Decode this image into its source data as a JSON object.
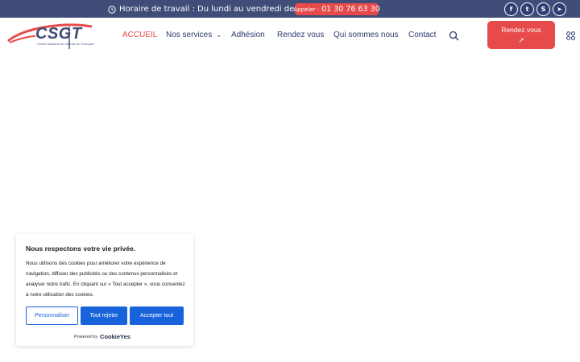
{
  "topbar": {
    "hours_text": "Horaire de travail : Du lundi au vendredi de 9h à 17h",
    "phone_prefix": "Appeler :",
    "phone_number": "01 30 76 63 30",
    "social": [
      {
        "icon": "facebook-icon",
        "glyph": "f"
      },
      {
        "icon": "twitter-icon",
        "glyph": "t"
      },
      {
        "icon": "skype-icon",
        "glyph": "S"
      },
      {
        "icon": "telegram-icon",
        "glyph": "➤"
      }
    ]
  },
  "header": {
    "logo_text": "CSGT",
    "logo_subtitle": "Centre Solidaire de Gestion du Transport",
    "nav": [
      {
        "label": "ACCUEIL",
        "active": true
      },
      {
        "label": "Nos services",
        "dropdown": true
      },
      {
        "label": "Adhésion"
      },
      {
        "label": "Rendez vous"
      },
      {
        "label": "Qui sommes nous"
      },
      {
        "label": "Contact"
      }
    ],
    "cta_label": "Rendez vous",
    "cta_arrow": "↗"
  },
  "cookie": {
    "title": "Nous respectons votre vie privée.",
    "text": "Nous utilisons des cookies pour améliorer votre expérience de navigation, diffuser des publicités ou des contenus personnalisés et analyser notre trafic. En cliquant sur « Tout accepter », vous consentez à notre utilisation des cookies.",
    "btn_customize": "Personnaliser",
    "btn_reject": "Tout rejeter",
    "btn_accept": "Accepter tout",
    "powered_by": "Powered by",
    "powered_brand": "CookieYes"
  },
  "colors": {
    "topbar": "#3f4d78",
    "accent": "#e74a4a",
    "nav_text": "#2b3a6b",
    "cookie_button": "#1863dc"
  }
}
